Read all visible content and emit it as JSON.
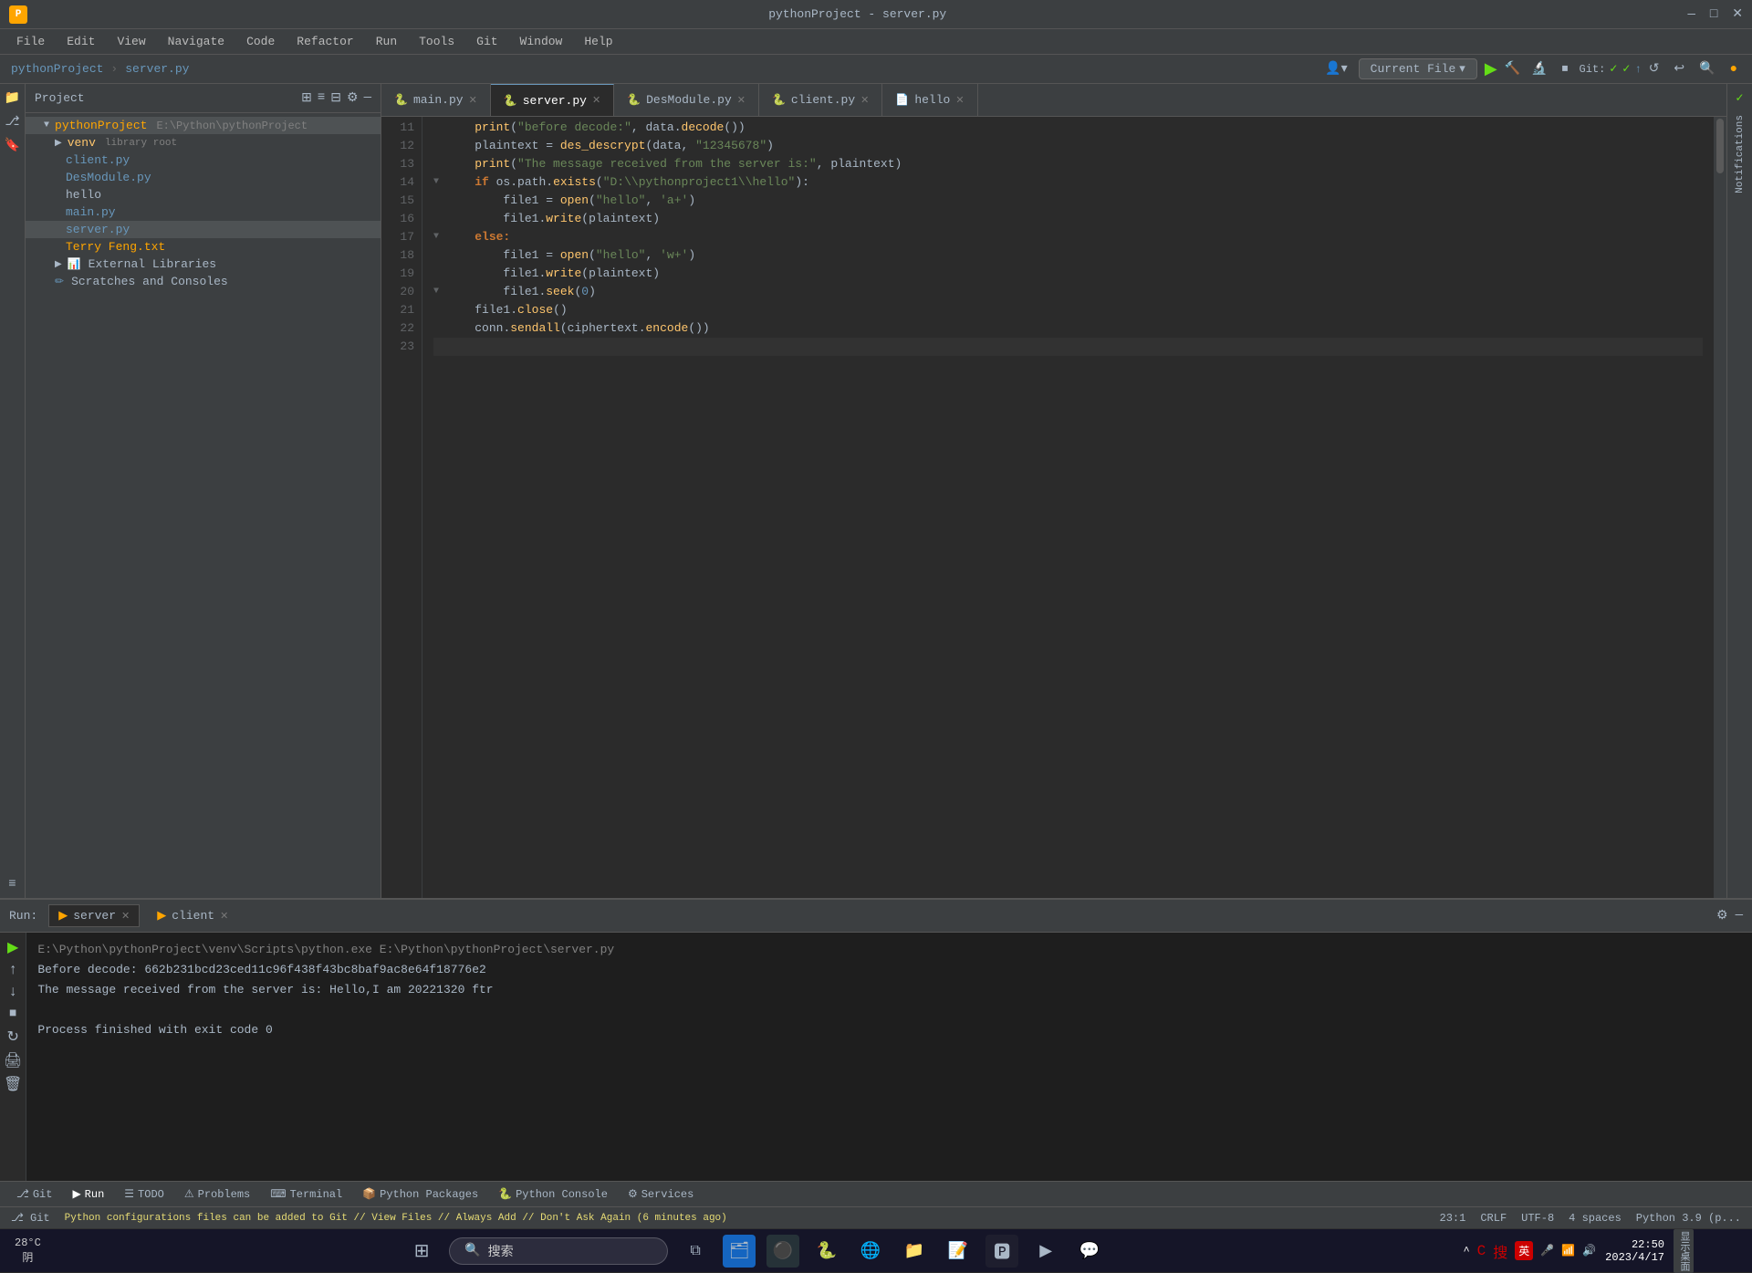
{
  "titlebar": {
    "logo": "P",
    "title": "pythonProject - server.py",
    "min_btn": "—",
    "max_btn": "□",
    "close_btn": "✕"
  },
  "menubar": {
    "items": [
      "File",
      "Edit",
      "View",
      "Navigate",
      "Code",
      "Refactor",
      "Run",
      "Tools",
      "Git",
      "Window",
      "Help"
    ]
  },
  "navbar": {
    "project": "pythonProject",
    "file": "server.py",
    "current_file_label": "Current File",
    "git_label": "Git:"
  },
  "project_panel": {
    "title": "Project",
    "root": "pythonProject",
    "root_path": "E:\\Python\\pythonProject",
    "items": [
      {
        "label": "venv",
        "type": "dir",
        "indent": 1,
        "icon": "📁",
        "suffix": "library root"
      },
      {
        "label": "client.py",
        "type": "python",
        "indent": 2,
        "icon": "🐍"
      },
      {
        "label": "DesModule.py",
        "type": "python",
        "indent": 2,
        "icon": "🐍"
      },
      {
        "label": "hello",
        "type": "gray",
        "indent": 2,
        "icon": "📄"
      },
      {
        "label": "main.py",
        "type": "python",
        "indent": 2,
        "icon": "🐍"
      },
      {
        "label": "server.py",
        "type": "python",
        "indent": 2,
        "icon": "🐍"
      },
      {
        "label": "Terry Feng.txt",
        "type": "orange",
        "indent": 2,
        "icon": "📄"
      },
      {
        "label": "External Libraries",
        "type": "dir",
        "indent": 1,
        "icon": "📚"
      },
      {
        "label": "Scratches and Consoles",
        "type": "gray",
        "indent": 1,
        "icon": "📋"
      }
    ]
  },
  "editor": {
    "tabs": [
      {
        "label": "main.py",
        "active": false,
        "icon": "🐍"
      },
      {
        "label": "server.py",
        "active": true,
        "icon": "🐍"
      },
      {
        "label": "DesModule.py",
        "active": false,
        "icon": "🐍"
      },
      {
        "label": "client.py",
        "active": false,
        "icon": "🐍"
      },
      {
        "label": "hello",
        "active": false,
        "icon": "📄"
      }
    ],
    "lines": [
      {
        "num": 11,
        "content": "    print(\"before decode:\", data.decode())",
        "has_fold": false
      },
      {
        "num": 12,
        "content": "    plaintext = des_descrypt(data, \"12345678\")",
        "has_fold": false
      },
      {
        "num": 13,
        "content": "    print(\"The message received from the server is:\", plaintext)",
        "has_fold": false
      },
      {
        "num": 14,
        "content": "    if os.path.exists(\"D:\\\\pythonproject1\\\\hello\"):",
        "has_fold": true
      },
      {
        "num": 15,
        "content": "        file1 = open(\"hello\", 'a+')",
        "has_fold": false
      },
      {
        "num": 16,
        "content": "        file1.write(plaintext)",
        "has_fold": false
      },
      {
        "num": 17,
        "content": "    else:",
        "has_fold": true
      },
      {
        "num": 18,
        "content": "        file1 = open(\"hello\", 'w+')",
        "has_fold": false
      },
      {
        "num": 19,
        "content": "        file1.write(plaintext)",
        "has_fold": false
      },
      {
        "num": 20,
        "content": "        file1.seek(0)",
        "has_fold": true
      },
      {
        "num": 21,
        "content": "    file1.close()",
        "has_fold": false
      },
      {
        "num": 22,
        "content": "    conn.sendall(ciphertext.encode())",
        "has_fold": false
      },
      {
        "num": 23,
        "content": "",
        "has_fold": false,
        "current": true
      }
    ]
  },
  "run_panel": {
    "label": "Run:",
    "tabs": [
      {
        "label": "server",
        "active": true,
        "icon": "▶"
      },
      {
        "label": "client",
        "active": false,
        "icon": "▶"
      }
    ],
    "console_lines": [
      {
        "text": "E:\\Python\\pythonProject\\venv\\Scripts\\python.exe E:\\Python\\pythonProject\\server.py",
        "style": "gray"
      },
      {
        "text": "Before decode: 662b231bcd23ced11c96f438f43bc8baf9ac8e64f18776e2",
        "style": "normal"
      },
      {
        "text": "The message received from the server is: Hello,I am 20221320 ftr",
        "style": "normal"
      },
      {
        "text": "",
        "style": "blank"
      },
      {
        "text": "Process finished with exit code 0",
        "style": "normal"
      },
      {
        "text": "",
        "style": "blank"
      },
      {
        "text": "",
        "style": "blank"
      }
    ]
  },
  "bottom_toolbar": {
    "items": [
      {
        "label": "Git",
        "icon": "⎇"
      },
      {
        "label": "Run",
        "icon": "▶",
        "active": true
      },
      {
        "label": "TODO",
        "icon": "☰"
      },
      {
        "label": "Problems",
        "icon": "⚠"
      },
      {
        "label": "Terminal",
        "icon": ">"
      },
      {
        "label": "Python Packages",
        "icon": "📦"
      },
      {
        "label": "Python Console",
        "icon": "🐍"
      },
      {
        "label": "Services",
        "icon": "⚙"
      }
    ]
  },
  "statusbar": {
    "git": "Git",
    "warning": "Python configurations files can be added to Git // View Files // Always Add // Don't Ask Again (6 minutes ago)",
    "position": "23:1",
    "crlf": "CRLF",
    "encoding": "UTF-8",
    "indent": "4 spaces",
    "python": "Python 3.9 (p..."
  },
  "taskbar": {
    "weather": {
      "temp": "28°C",
      "condition": "阴"
    },
    "search_placeholder": "搜索",
    "clock": {
      "time": "22:50",
      "date": "2023/4/17"
    },
    "ime": "英",
    "watermark": "显示桌面"
  }
}
